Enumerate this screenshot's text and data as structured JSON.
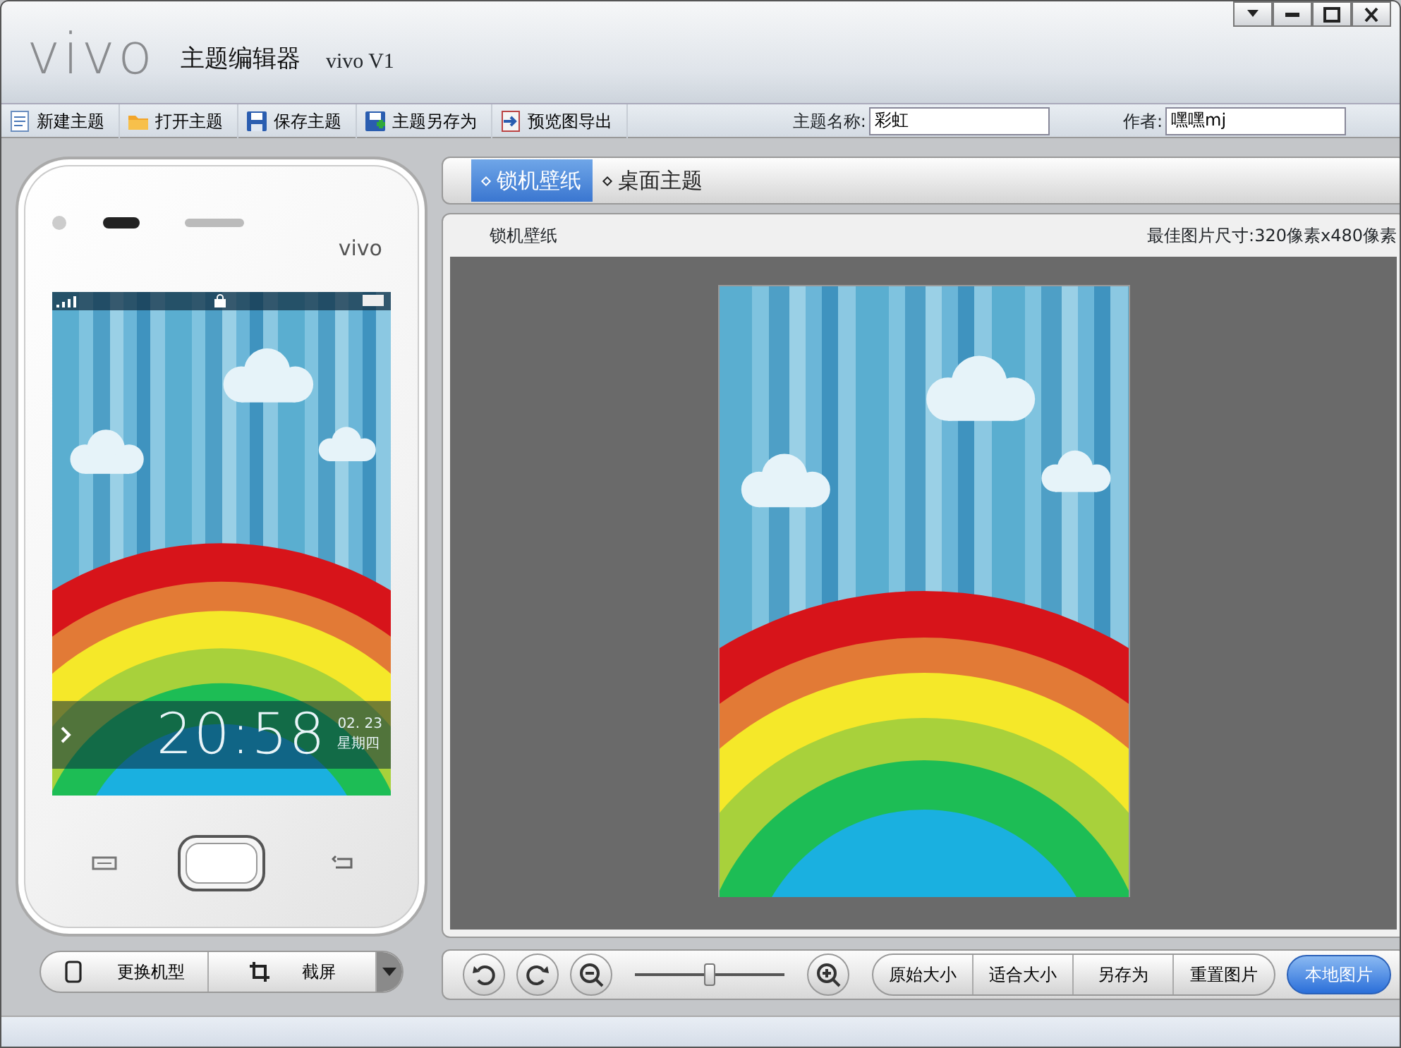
{
  "window": {
    "logo": "vivo",
    "title": "主题编辑器",
    "version": "vivo V1"
  },
  "toolbar": [
    {
      "label": "新建主题",
      "kind": "new"
    },
    {
      "label": "打开主题",
      "kind": "open"
    },
    {
      "label": "保存主题",
      "kind": "save"
    },
    {
      "label": "主题另存为",
      "kind": "saveas"
    },
    {
      "label": "预览图导出",
      "kind": "export"
    }
  ],
  "fields": [
    {
      "label": "主题名称:",
      "value": "彩虹"
    },
    {
      "label": "作者:",
      "value": "嘿嘿mj"
    }
  ],
  "phone": {
    "brand": "vivo",
    "time": "20:58",
    "date": "02. 23",
    "weekday": "星期四"
  },
  "phone_actions": [
    {
      "label": "更换机型",
      "kind": "phone"
    },
    {
      "label": "截屏",
      "kind": "crop"
    }
  ],
  "tabs": [
    {
      "label": "锁机壁纸",
      "selected": true
    },
    {
      "label": "桌面主题",
      "selected": false
    }
  ],
  "panel": {
    "title": "锁机壁纸",
    "hint": "最佳图片尺寸:320像素x480像素"
  },
  "zoom": {
    "level": 0.5
  },
  "view_buttons": [
    "原始大小",
    "适合大小",
    "另存为",
    "重置图片"
  ],
  "primary_button": "本地图片"
}
